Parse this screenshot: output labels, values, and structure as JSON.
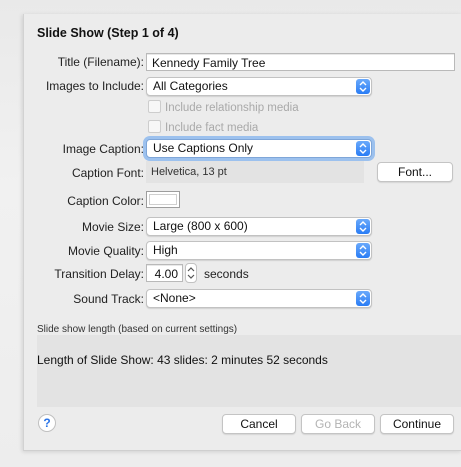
{
  "dialog": {
    "title": "Slide Show (Step 1 of 4)"
  },
  "fields": {
    "title_label": "Title (Filename):",
    "title_value": "Kennedy Family Tree",
    "images_label": "Images to Include:",
    "images_value": "All Categories",
    "check_relationship": "Include relationship media",
    "check_fact": "Include fact media",
    "caption_label": "Image Caption:",
    "caption_value": "Use Captions Only",
    "font_label": "Caption Font:",
    "font_value": "Helvetica, 13 pt",
    "font_button": "Font...",
    "color_label": "Caption Color:",
    "caption_color": "#ffffff",
    "size_label": "Movie Size:",
    "size_value": "Large (800 x 600)",
    "quality_label": "Movie Quality:",
    "quality_value": "High",
    "delay_label": "Transition Delay:",
    "delay_value": "4.00",
    "delay_unit": "seconds",
    "sound_label": "Sound Track:",
    "sound_value": "<None>"
  },
  "summary": {
    "caption": "Slide show length (based on current settings)",
    "text": "Length of Slide Show:  43 slides: 2 minutes 52 seconds"
  },
  "footer": {
    "help": "?",
    "cancel": "Cancel",
    "go_back": "Go Back",
    "continue": "Continue"
  },
  "icons": {
    "popup": "up-down-chevron-icon",
    "stepper": "stepper-arrows-icon",
    "help": "help-icon"
  },
  "colors": {
    "accent": "#2a7cf5",
    "focus_ring": "#9cc1ee"
  }
}
